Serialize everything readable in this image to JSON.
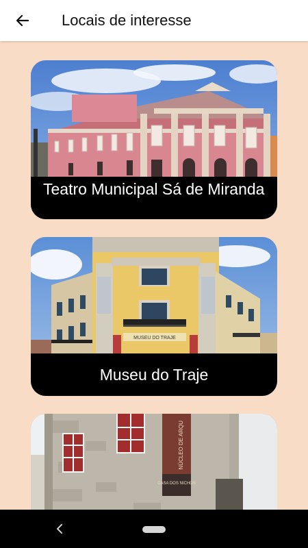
{
  "header": {
    "title": "Locais de interesse",
    "back_icon": "arrow-left-icon"
  },
  "places": [
    {
      "name": "Teatro Municipal Sá de Miranda"
    },
    {
      "name": "Museu do Traje",
      "sign": "MUSEU DO TRAJE"
    },
    {
      "name": "",
      "sign_vertical": "NÚCLEO DE ARQU",
      "sign_lower": "CASA DOS NICHOS"
    }
  ],
  "system_nav": {
    "back_icon": "chevron-left-icon",
    "home_icon": "home-pill-icon"
  },
  "colors": {
    "background": "#f9dcc6",
    "appbar": "#ffffff",
    "caption_bg": "#000000",
    "caption_text": "#ffffff"
  }
}
